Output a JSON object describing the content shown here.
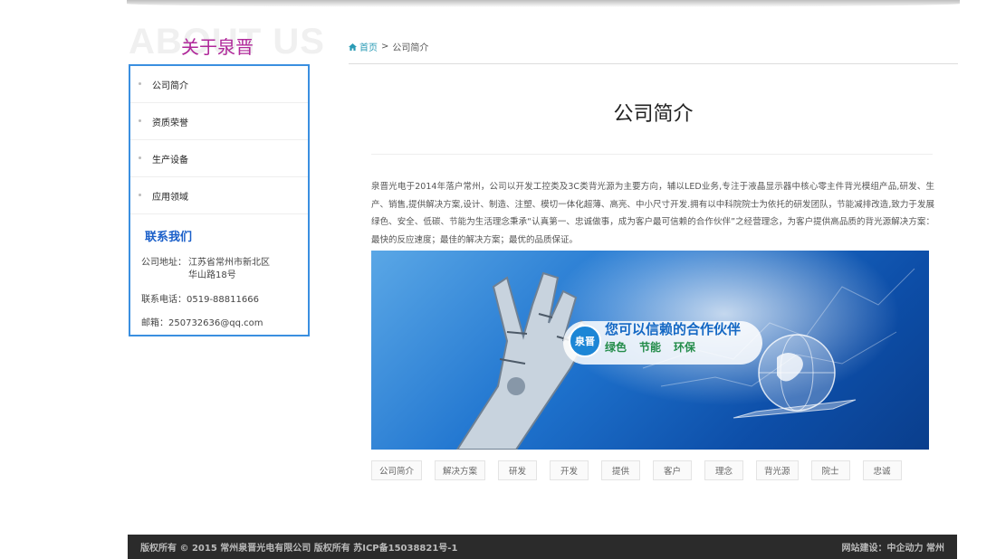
{
  "sidebar": {
    "heading_bg": "ABOUT US",
    "heading": "关于泉晋",
    "items": [
      {
        "label": "公司简介"
      },
      {
        "label": "资质荣誉"
      },
      {
        "label": "生产设备"
      },
      {
        "label": "应用领域"
      }
    ],
    "contact": {
      "title": "联系我们",
      "address_label": "公司地址：",
      "address_line1": "江苏省常州市新北区",
      "address_line2": "华山路18号",
      "phone": "联系电话：0519-88811666",
      "email": "邮箱：250732636@qq.com"
    }
  },
  "breadcrumb": {
    "home": "首页",
    "separator": ">",
    "current": "公司简介"
  },
  "main": {
    "title": "公司简介",
    "body": "泉晋光电于2014年落户常州，公司以开发工控类及3C类背光源为主要方向，辅以LED业务,专注于液晶显示器中核心零主件背光模组产品,研发、生产、销售,提供解决方案,设计、制造、注塑、模切一体化超薄、高亮、中小尺寸开发.拥有以中科院院士为依托的研发团队，节能减排改造,致力于发展绿色、安全、低碳、节能为生活理念秉承“认真第一、忠诚做事，成为客户最可信赖的合作伙伴”之经营理念，为客户提供高品质的背光源解决方案：最快的反应速度；最佳的解决方案；最优的品质保证。",
    "banner": {
      "badge": "泉晋",
      "slogan": "您可以信赖的合作伙伴",
      "sub1": "绿色",
      "sub2": "节能",
      "sub3": "环保"
    },
    "tags": [
      "公司简介",
      "解决方案",
      "研发",
      "开发",
      "提供",
      "客户",
      "理念",
      "背光源",
      "院士",
      "忠诚"
    ]
  },
  "footer": {
    "copyright": "版权所有 © 2015 常州泉晋光电有限公司 版权所有 苏ICP备15038821号-1",
    "credit": "网站建设：中企动力 常州"
  },
  "colors": {
    "accent": "#3a8fe0",
    "heading": "#b0289a",
    "contact_title": "#1a5fc9",
    "footer_bg": "#2b2b2b"
  }
}
